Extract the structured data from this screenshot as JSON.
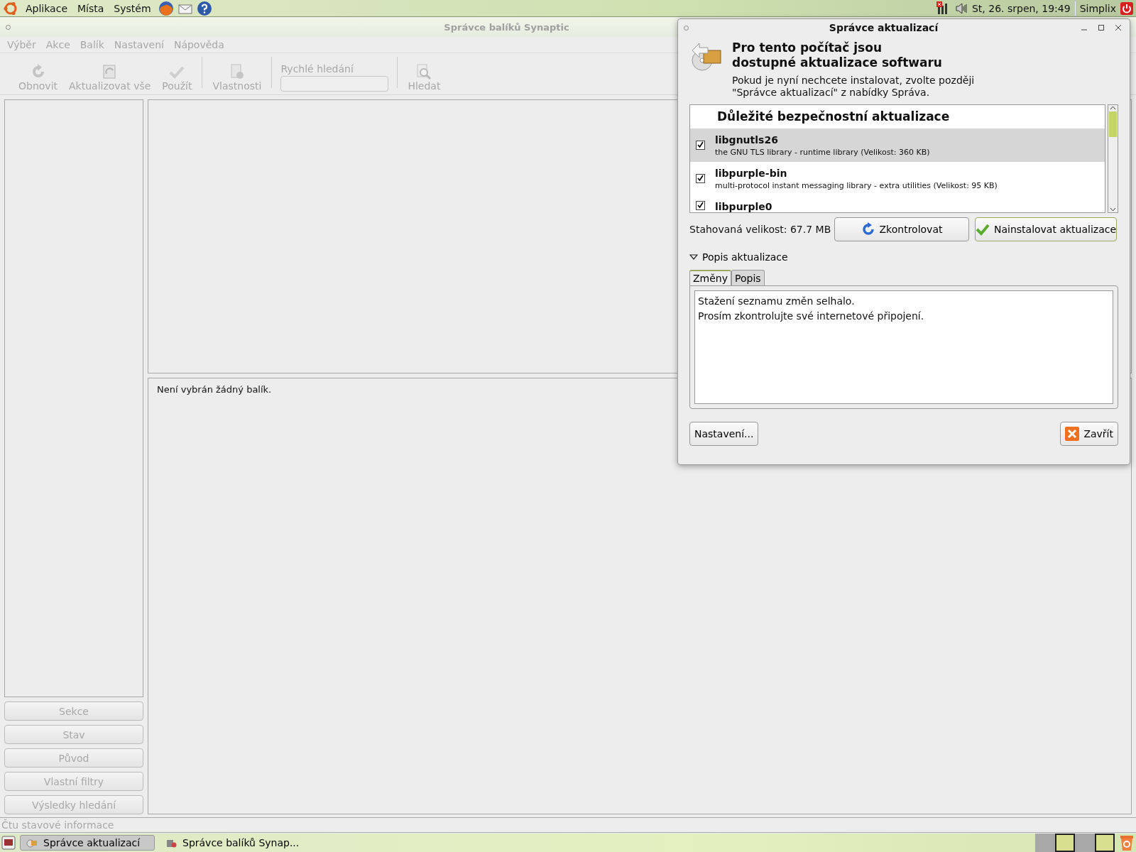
{
  "top_panel": {
    "menus": [
      "Aplikace",
      "Místa",
      "Systém"
    ],
    "clock": "St, 26. srpen, 19:49",
    "user": "Simplix"
  },
  "synaptic": {
    "title": "Správce balíků Synaptic",
    "menu": [
      "Výběr",
      "Akce",
      "Balík",
      "Nastavení",
      "Nápověda"
    ],
    "toolbar": [
      {
        "kind": "refresh",
        "label": "Obnovit",
        "disabled": true
      },
      {
        "kind": "upgrade",
        "label": "Aktualizovat vše",
        "disabled": true
      },
      {
        "kind": "apply",
        "label": "Použít",
        "disabled": true
      },
      {
        "kind": "properties",
        "label": "Vlastnosti",
        "disabled": true
      },
      {
        "kind": "search",
        "label": "Hledat",
        "disabled": true
      }
    ],
    "quick_search": {
      "label": "Rychlé hledání"
    },
    "details_text": "Není vybrán žádný balík.",
    "filter_buttons": [
      {
        "label": "Sekce",
        "disabled": true
      },
      {
        "label": "Stav",
        "disabled": true
      },
      {
        "label": "Původ",
        "disabled": true
      },
      {
        "label": "Vlastní filtry",
        "disabled": true
      },
      {
        "label": "Výsledky hledání",
        "disabled": true
      }
    ],
    "status_bar": "Čtu stavové informace"
  },
  "dialog": {
    "title": "Správce aktualizací",
    "heading": "Pro tento počítač jsou dostupné aktualizace softwaru",
    "subtext": "Pokud je nyní nechcete instalovat, zvolte později \"Správce aktualizací\" z nabídky Správa.",
    "updates": [
      {
        "kind": "header",
        "name": "Důležité bezpečnostní aktualizace"
      },
      {
        "kind": "package",
        "name": "libgnutls26",
        "description": "the GNU TLS library - runtime library (Velikost: 360 KB)",
        "checked": true,
        "selected": true
      },
      {
        "kind": "package",
        "name": "libpurple-bin",
        "description": "multi-protocol instant messaging library - extra utilities (Velikost: 95 KB)",
        "checked": true,
        "selected": false
      },
      {
        "kind": "package",
        "name": "libpurple0",
        "checked": true,
        "selected": false
      }
    ],
    "download_size": "Stahovaná velikost: 67.7 MB",
    "check_button": "Zkontrolovat",
    "install_button": "Nainstalovat aktualizace",
    "expander": {
      "label": "Popis aktualizace",
      "expanded": true
    },
    "tabs": [
      {
        "label": "Změny",
        "selected": true
      },
      {
        "label": "Popis",
        "selected": false
      }
    ],
    "changes_text": [
      "Stažení seznamu změn selhalo.",
      "Prosím zkontrolujte své internetové připojení."
    ],
    "settings_button": "Nastavení...",
    "close_button": "Zavřít"
  },
  "taskbar": {
    "tasks": [
      {
        "kind": "updates",
        "label": "Správce aktualizací",
        "selected": true
      },
      {
        "kind": "synaptic",
        "label": "Správce balíků Synap...",
        "selected": false
      }
    ]
  }
}
